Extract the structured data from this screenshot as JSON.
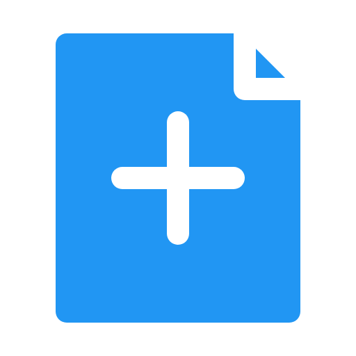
{
  "icon": {
    "name": "new-file-icon",
    "symbol": "plus",
    "colors": {
      "fill": "#2196F3",
      "symbol": "#FFFFFF",
      "background": "#FFFFFF"
    }
  }
}
